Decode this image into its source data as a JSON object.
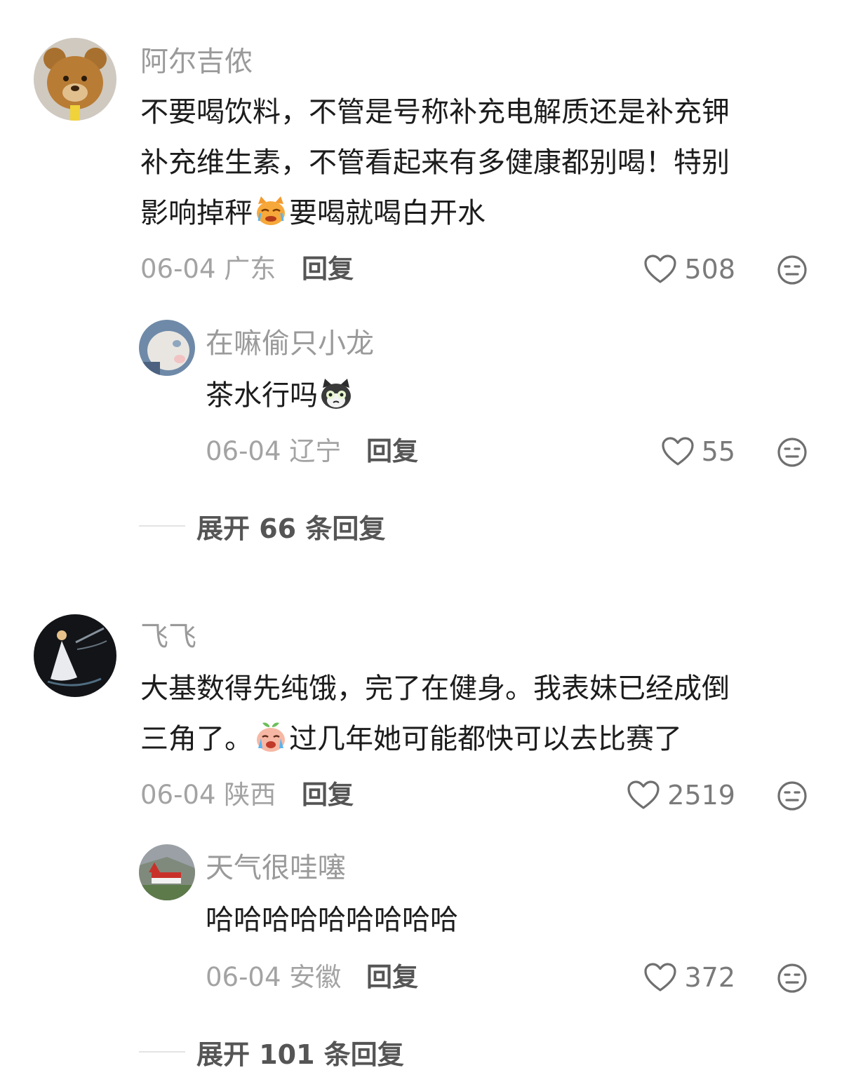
{
  "comments": [
    {
      "user": "阿尔吉侬",
      "avatar": "teddy-bear-avatar",
      "lines": [
        "不要喝饮料，不管是号称补充电解质还是补充钾",
        "补充维生素，不管看起来有多健康都别喝！特别"
      ],
      "last_line_before_emoji": "影响掉秤",
      "emoji": "crying-cat-emoji",
      "last_line_after_emoji": "要喝就喝白开水",
      "date": "06-04",
      "location": "广东",
      "reply_label": "回复",
      "likes": "508",
      "sub_reply": {
        "user": "在嘛偷只小龙",
        "avatar": "white-cat-avatar",
        "text": "茶水行吗",
        "emoji": "shocked-cat-emoji",
        "date": "06-04",
        "location": "辽宁",
        "reply_label": "回复",
        "likes": "55"
      },
      "expand_label": "展开 66 条回复"
    },
    {
      "user": "飞飞",
      "avatar": "dancer-avatar",
      "line1": "大基数得先纯饿，完了在健身。我表妹已经成倒",
      "line2_before_emoji": "三角了。",
      "emoji": "crying-peach-emoji",
      "line2_after_emoji": "过几年她可能都快可以去比赛了",
      "date": "06-04",
      "location": "陕西",
      "reply_label": "回复",
      "likes": "2519",
      "sub_reply": {
        "user": "天气很哇噻",
        "avatar": "church-landscape-avatar",
        "text": "哈哈哈哈哈哈哈哈哈",
        "date": "06-04",
        "location": "安徽",
        "reply_label": "回复",
        "likes": "372"
      },
      "expand_label": "展开 101 条回复"
    }
  ],
  "icons": {
    "like": "heart-outline-icon",
    "dislike": "neutral-face-icon"
  },
  "colors": {
    "username": "#9a9a9a",
    "meta": "#a3a3a3",
    "text": "#1c1c1c",
    "icon": "#6f6f6f"
  }
}
